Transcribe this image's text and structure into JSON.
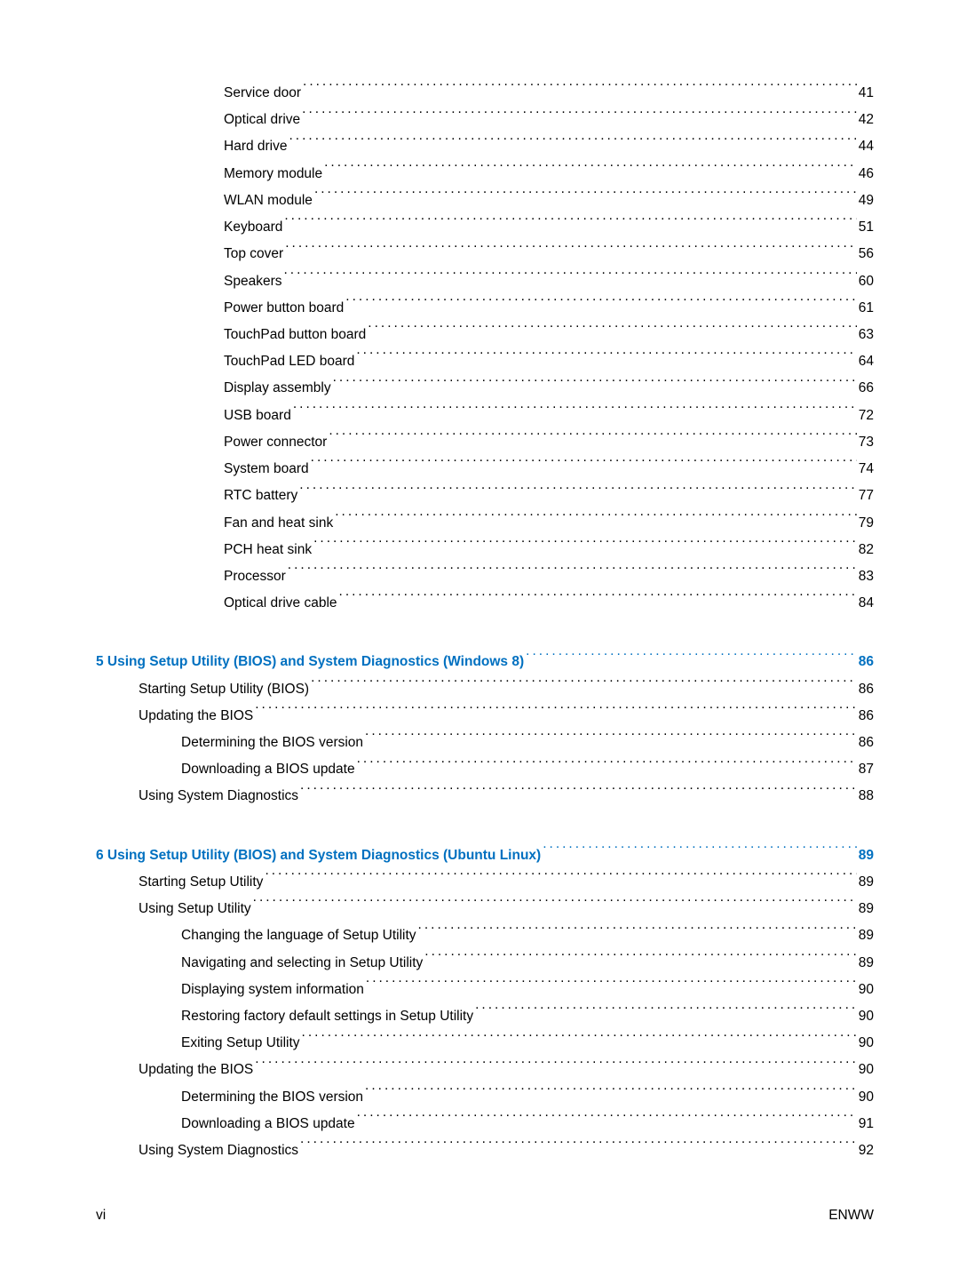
{
  "toc": {
    "section1": [
      {
        "label": "Service door",
        "page": "41",
        "indent": 3
      },
      {
        "label": "Optical drive",
        "page": "42",
        "indent": 3
      },
      {
        "label": "Hard drive",
        "page": "44",
        "indent": 3
      },
      {
        "label": "Memory module",
        "page": "46",
        "indent": 3
      },
      {
        "label": "WLAN module",
        "page": "49",
        "indent": 3
      },
      {
        "label": "Keyboard",
        "page": "51",
        "indent": 3
      },
      {
        "label": "Top cover",
        "page": "56",
        "indent": 3
      },
      {
        "label": "Speakers",
        "page": "60",
        "indent": 3
      },
      {
        "label": "Power button board",
        "page": "61",
        "indent": 3
      },
      {
        "label": "TouchPad button board",
        "page": "63",
        "indent": 3
      },
      {
        "label": "TouchPad LED board",
        "page": "64",
        "indent": 3
      },
      {
        "label": "Display assembly",
        "page": "66",
        "indent": 3
      },
      {
        "label": "USB board",
        "page": "72",
        "indent": 3
      },
      {
        "label": "Power connector",
        "page": "73",
        "indent": 3
      },
      {
        "label": "System board",
        "page": "74",
        "indent": 3
      },
      {
        "label": "RTC battery",
        "page": "77",
        "indent": 3
      },
      {
        "label": "Fan and heat sink",
        "page": "79",
        "indent": 3
      },
      {
        "label": "PCH heat sink",
        "page": "82",
        "indent": 3
      },
      {
        "label": "Processor",
        "page": "83",
        "indent": 3
      },
      {
        "label": "Optical drive cable",
        "page": "84",
        "indent": 3
      }
    ],
    "chapter5": {
      "label": "5  Using Setup Utility (BIOS) and System Diagnostics (Windows 8)",
      "page": "86"
    },
    "section5": [
      {
        "label": "Starting Setup Utility (BIOS)",
        "page": "86",
        "indent": 1
      },
      {
        "label": "Updating the BIOS",
        "page": "86",
        "indent": 1
      },
      {
        "label": "Determining the BIOS version",
        "page": "86",
        "indent": 2
      },
      {
        "label": "Downloading a BIOS update",
        "page": "87",
        "indent": 2
      },
      {
        "label": "Using System Diagnostics",
        "page": "88",
        "indent": 1
      }
    ],
    "chapter6": {
      "label": "6  Using Setup Utility (BIOS) and System Diagnostics (Ubuntu Linux)",
      "page": "89"
    },
    "section6": [
      {
        "label": "Starting Setup Utility",
        "page": "89",
        "indent": 1
      },
      {
        "label": "Using Setup Utility",
        "page": "89",
        "indent": 1
      },
      {
        "label": "Changing the language of Setup Utility",
        "page": "89",
        "indent": 2
      },
      {
        "label": "Navigating and selecting in Setup Utility",
        "page": "89",
        "indent": 2
      },
      {
        "label": "Displaying system information",
        "page": "90",
        "indent": 2
      },
      {
        "label": "Restoring factory default settings in Setup Utility",
        "page": "90",
        "indent": 2
      },
      {
        "label": "Exiting Setup Utility",
        "page": "90",
        "indent": 2
      },
      {
        "label": "Updating the BIOS",
        "page": "90",
        "indent": 1
      },
      {
        "label": "Determining the BIOS version",
        "page": "90",
        "indent": 2
      },
      {
        "label": "Downloading a BIOS update",
        "page": "91",
        "indent": 2
      },
      {
        "label": "Using System Diagnostics",
        "page": "92",
        "indent": 1
      }
    ]
  },
  "footer": {
    "left": "vi",
    "right": "ENWW"
  }
}
